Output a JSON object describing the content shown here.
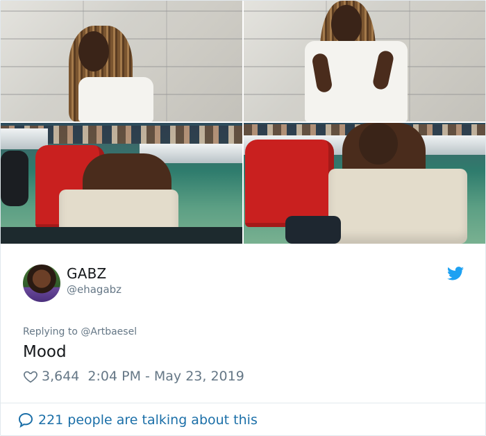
{
  "tweet": {
    "display_name": "GABZ",
    "handle": "@ehagabz",
    "replying_prefix": "Replying to",
    "replying_to": "@Artbaesel",
    "text": "Mood",
    "likes": "3,644",
    "timestamp": "2:04 PM - May 23, 2019",
    "conversation": "221 people are talking about this"
  },
  "icons": {
    "brand": "twitter-bird-icon",
    "like": "heart-icon",
    "reply": "speech-bubble-icon"
  },
  "colors": {
    "brand_blue": "#1da1f2",
    "link_blue": "#1b6fa8",
    "secondary_text": "#657786",
    "border": "#e1e8ed"
  },
  "media": {
    "photo_count": 4
  }
}
